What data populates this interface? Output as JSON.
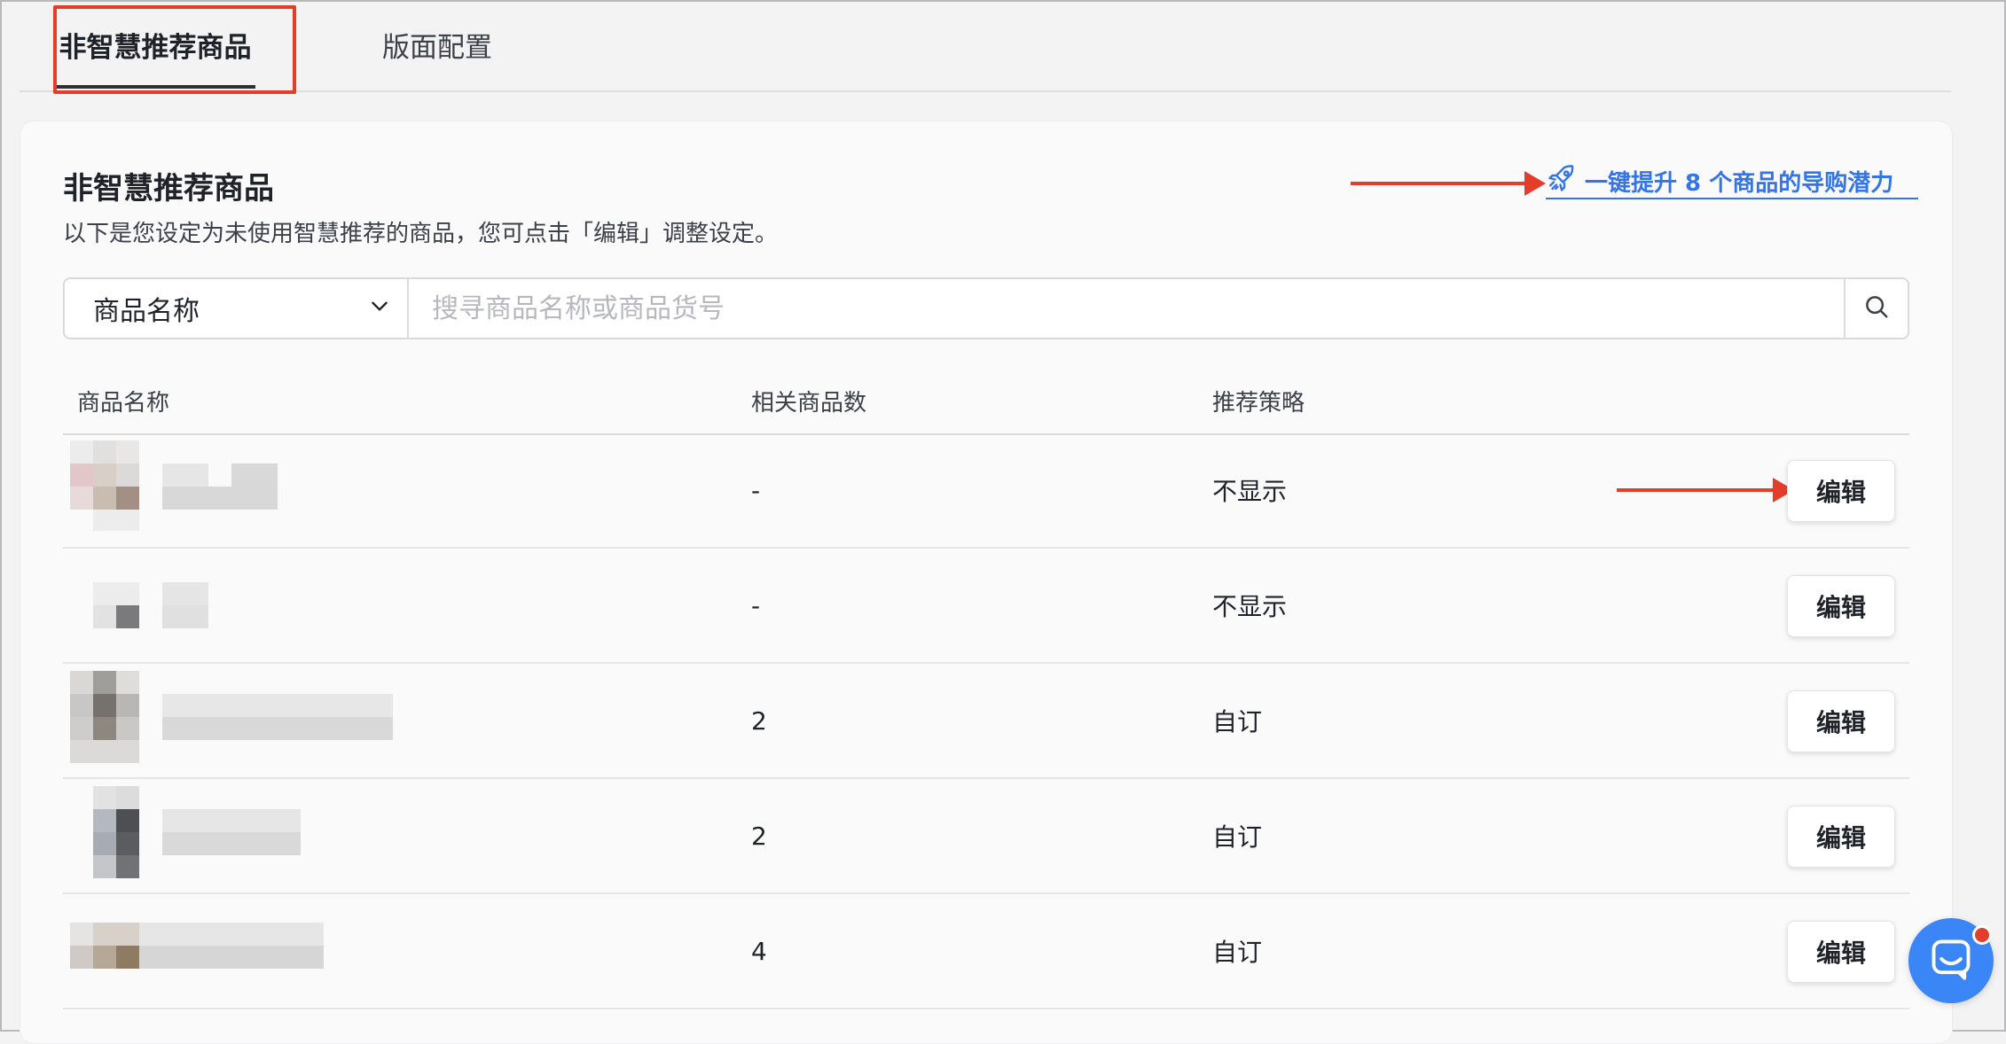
{
  "tabs": [
    {
      "label": "非智慧推荐商品"
    },
    {
      "label": "版面配置"
    }
  ],
  "card": {
    "title": "非智慧推荐商品",
    "description": "以下是您设定为未使用智慧推荐的商品，您可点击「编辑」调整设定。",
    "boost_link": "一键提升 8 个商品的导购潜力",
    "boost_icon": "rocket-icon"
  },
  "search": {
    "filter_value": "商品名称",
    "placeholder": "搜寻商品名称或商品货号"
  },
  "table": {
    "headers": [
      "商品名称",
      "相关商品数",
      "推荐策略"
    ],
    "rows": [
      {
        "related_count": "-",
        "strategy": "不显示",
        "edit_label": "编辑"
      },
      {
        "related_count": "-",
        "strategy": "不显示",
        "edit_label": "编辑"
      },
      {
        "related_count": "2",
        "strategy": "自订",
        "edit_label": "编辑"
      },
      {
        "related_count": "2",
        "strategy": "自订",
        "edit_label": "编辑"
      },
      {
        "related_count": "4",
        "strategy": "自订",
        "edit_label": "编辑"
      }
    ]
  },
  "colors": {
    "accent": "#3574e6",
    "annotation": "#e43d29",
    "chat": "#3b86f6"
  }
}
